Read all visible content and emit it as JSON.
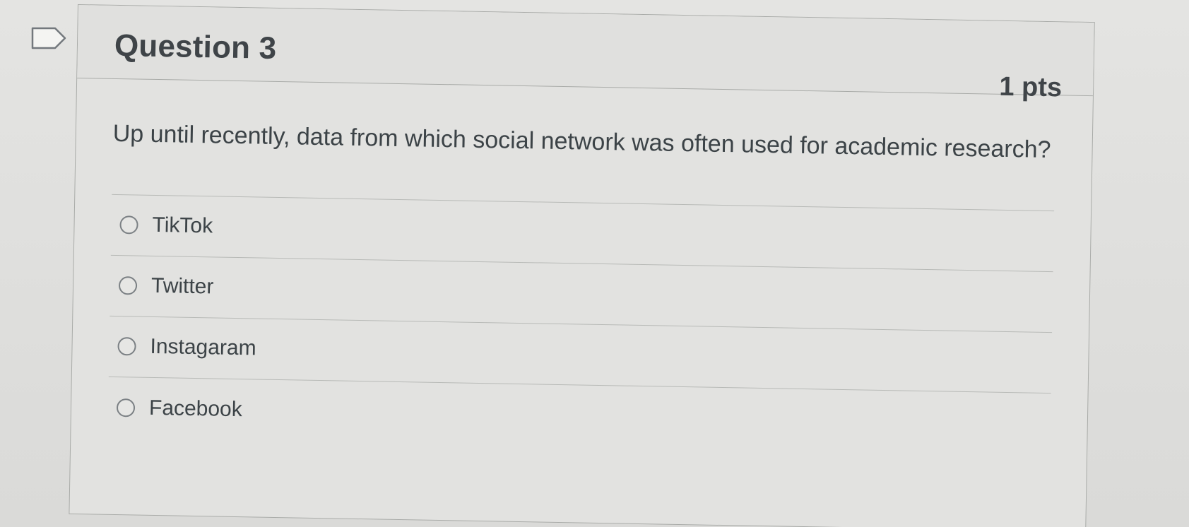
{
  "question": {
    "title": "Question 3",
    "points": "1 pts",
    "text": "Up until recently, data from which social network was often used for academic research?",
    "answers": [
      {
        "label": "TikTok"
      },
      {
        "label": "Twitter"
      },
      {
        "label": "Instagaram"
      },
      {
        "label": "Facebook"
      }
    ]
  },
  "icons": {
    "flag": "flag-question-icon"
  },
  "colors": {
    "text": "#3c4347",
    "border": "#a9aba8",
    "background": "#e2e2e0"
  }
}
